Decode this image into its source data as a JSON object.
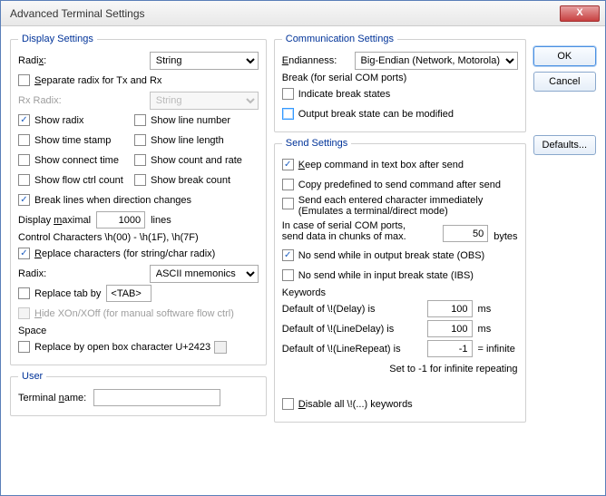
{
  "title": "Advanced Terminal Settings",
  "buttons": {
    "ok": "OK",
    "cancel": "Cancel",
    "defaults": "Defaults...",
    "close": "X"
  },
  "display": {
    "legend": "Display Settings",
    "radix_label": "Radix:",
    "radix_value": "String",
    "separate": "Separate radix for Tx and Rx",
    "rx_radix_label": "Rx Radix:",
    "rx_radix_value": "String",
    "show_radix": "Show radix",
    "show_line_number": "Show line number",
    "show_time_stamp": "Show time stamp",
    "show_line_length": "Show line length",
    "show_connect_time": "Show connect time",
    "show_count_rate": "Show count and rate",
    "show_flow_ctrl": "Show flow ctrl count",
    "show_break_count": "Show break count",
    "break_lines": "Break lines when direction changes",
    "display_maximal_label": "Display maximal",
    "display_maximal_value": "1000",
    "display_maximal_suffix": "lines",
    "ctrl_chars_label": "Control Characters \\h(00) - \\h(1F), \\h(7F)",
    "replace_chars": "Replace characters (for string/char radix)",
    "cc_radix_label": "Radix:",
    "cc_radix_value": "ASCII mnemonics",
    "replace_tab": "Replace tab by",
    "replace_tab_value": "<TAB>",
    "hide_xon": "Hide XOn/XOff (for manual software flow ctrl)",
    "space_label": "Space",
    "replace_space": "Replace by open box character U+2423"
  },
  "user": {
    "legend": "User",
    "terminal_name_label": "Terminal name:",
    "terminal_name_value": ""
  },
  "comm": {
    "legend": "Communication Settings",
    "endianness_label": "Endianness:",
    "endianness_value": "Big-Endian (Network, Motorola)",
    "break_label": "Break (for serial COM ports)",
    "indicate_break": "Indicate break states",
    "output_break": "Output break state can be modified"
  },
  "send": {
    "legend": "Send Settings",
    "keep_cmd": "Keep command in text box after send",
    "copy_predef": "Copy predefined to send command after send",
    "send_each1": "Send each entered character immediately",
    "send_each2": "(Emulates a terminal/direct mode)",
    "in_case1": "In case of serial COM ports,",
    "in_case2": "send data in chunks of max.",
    "chunk_value": "50",
    "chunk_suffix": "bytes",
    "no_send_obs": "No send while in output break state (OBS)",
    "no_send_ibs": "No send while in input break state (IBS)",
    "keywords_label": "Keywords",
    "delay_label": "Default of \\!(Delay) is",
    "delay_value": "100",
    "delay_suffix": "ms",
    "linedelay_label": "Default of \\!(LineDelay) is",
    "linedelay_value": "100",
    "linedelay_suffix": "ms",
    "linerepeat_label": "Default of \\!(LineRepeat) is",
    "linerepeat_value": "-1",
    "linerepeat_suffix": "= infinite",
    "repeat_note": "Set to -1 for infinite repeating",
    "disable_all": "Disable all \\!(...) keywords"
  }
}
